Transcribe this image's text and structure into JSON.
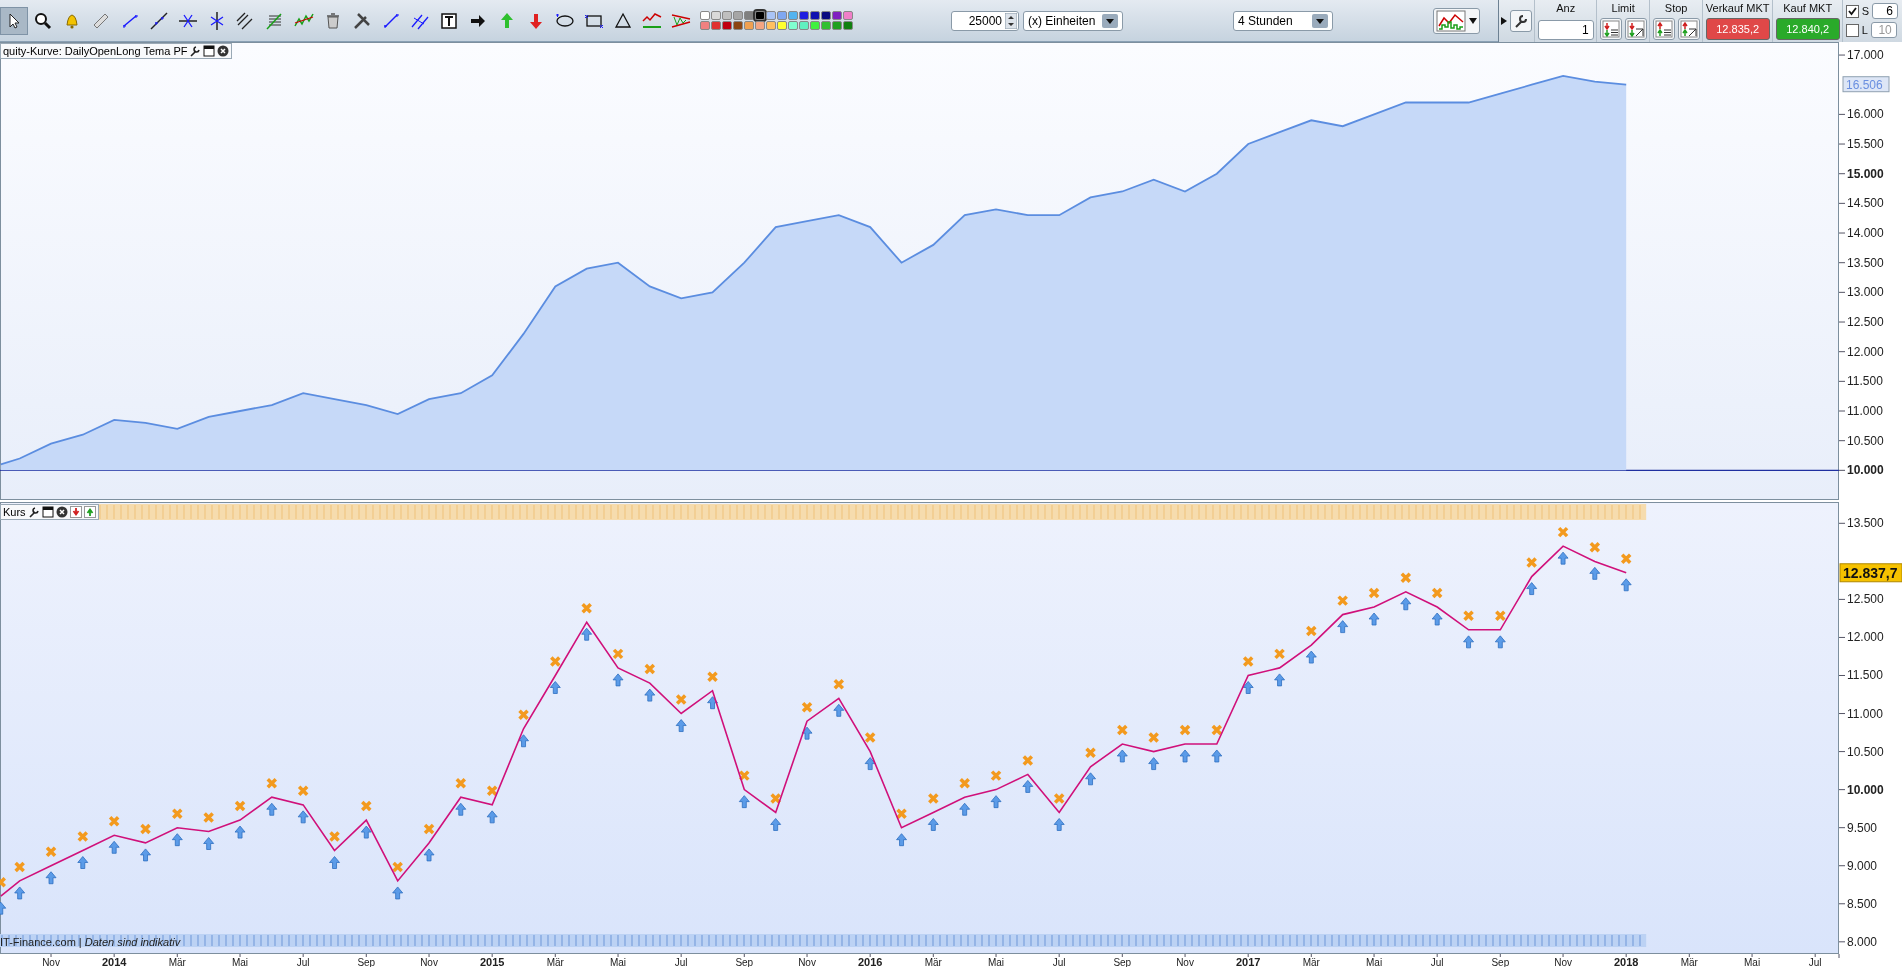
{
  "toolbar": {
    "tools": [
      {
        "kind": "pointer",
        "selected": true
      },
      {
        "kind": "search",
        "selected": false
      },
      {
        "kind": "alert",
        "selected": false
      },
      {
        "kind": "ruler",
        "selected": false
      },
      {
        "kind": "segment",
        "selected": false
      },
      {
        "kind": "line",
        "selected": false
      },
      {
        "kind": "hline",
        "selected": false
      },
      {
        "kind": "vline",
        "selected": false
      },
      {
        "kind": "channel",
        "selected": false
      },
      {
        "kind": "fibonacci",
        "selected": false
      },
      {
        "kind": "wave",
        "selected": false
      },
      {
        "kind": "trash",
        "selected": false
      },
      {
        "kind": "tools",
        "selected": false
      },
      {
        "kind": "cross",
        "selected": false
      },
      {
        "kind": "parallel",
        "selected": false
      },
      {
        "kind": "text",
        "selected": false
      },
      {
        "kind": "arrow-right",
        "selected": false
      },
      {
        "kind": "arrow-up",
        "selected": false
      },
      {
        "kind": "arrow-down",
        "selected": false
      },
      {
        "kind": "ellipse",
        "selected": false
      },
      {
        "kind": "rectangle",
        "selected": false
      },
      {
        "kind": "triangle",
        "selected": false
      },
      {
        "kind": "trend",
        "selected": false
      },
      {
        "kind": "wedge",
        "selected": false
      }
    ],
    "palette": [
      {
        "color": "#ffffff",
        "selected": false
      },
      {
        "color": "#d9d9d9",
        "selected": false
      },
      {
        "color": "#bfbfbf",
        "selected": false
      },
      {
        "color": "#a6a6a6",
        "selected": false
      },
      {
        "color": "#808080",
        "selected": false
      },
      {
        "color": "#000000",
        "selected": true
      },
      {
        "color": "#a9c4f5",
        "selected": false
      },
      {
        "color": "#7fa7f0",
        "selected": false
      },
      {
        "color": "#53b3ee",
        "selected": false
      },
      {
        "color": "#1f1fe0",
        "selected": false
      },
      {
        "color": "#1010b0",
        "selected": false
      },
      {
        "color": "#0a0a80",
        "selected": false
      },
      {
        "color": "#8020c0",
        "selected": false
      },
      {
        "color": "#f07fc8",
        "selected": false
      },
      {
        "color": "#f08080",
        "selected": false
      },
      {
        "color": "#e03030",
        "selected": false
      },
      {
        "color": "#c00010",
        "selected": false
      },
      {
        "color": "#8b4513",
        "selected": false
      },
      {
        "color": "#f0a050",
        "selected": false
      },
      {
        "color": "#f4a582",
        "selected": false
      },
      {
        "color": "#ffc060",
        "selected": false
      },
      {
        "color": "#ffff30",
        "selected": false
      },
      {
        "color": "#80ffd0",
        "selected": false
      },
      {
        "color": "#60f0c0",
        "selected": false
      },
      {
        "color": "#40f040",
        "selected": false
      },
      {
        "color": "#30c030",
        "selected": false
      },
      {
        "color": "#20a020",
        "selected": false
      },
      {
        "color": "#108010",
        "selected": false
      }
    ],
    "quantity": {
      "value": "25000"
    },
    "unit_dropdown": {
      "value": "(x) Einheiten"
    },
    "timeframe_dropdown": {
      "value": "4 Stunden"
    },
    "order_panel": {
      "quantity_label": "Anz",
      "quantity": "1",
      "limit_label": "Limit",
      "stop_label": "Stop",
      "sell": {
        "label": "Verkauf MKT",
        "price": "12.835,2"
      },
      "buy": {
        "label": "Kauf MKT",
        "price": "12.840,2"
      },
      "options": [
        {
          "label": "S",
          "checked": true,
          "value": "6"
        },
        {
          "label": "L",
          "checked": false,
          "value": "10"
        }
      ]
    }
  },
  "equity_panel": {
    "last_value": "16.506",
    "chart_data": {
      "type": "area",
      "x": [
        2013.7,
        2013.75,
        2013.833,
        2013.917,
        2014,
        2014.083,
        2014.167,
        2014.25,
        2014.333,
        2014.417,
        2014.5,
        2014.583,
        2014.667,
        2014.75,
        2014.833,
        2014.917,
        2015,
        2015.083,
        2015.167,
        2015.25,
        2015.333,
        2015.417,
        2015.5,
        2015.583,
        2015.667,
        2015.75,
        2015.833,
        2015.917,
        2016,
        2016.083,
        2016.167,
        2016.25,
        2016.333,
        2016.417,
        2016.5,
        2016.583,
        2016.667,
        2016.75,
        2016.833,
        2016.917,
        2017,
        2017.083,
        2017.167,
        2017.25,
        2017.333,
        2017.417,
        2017.5,
        2017.583,
        2017.667,
        2017.75,
        2017.833,
        2017.917,
        2018
      ],
      "series": [
        {
          "name": "quity-Kurve: DailyOpenLong Tema PF",
          "color": "#5b8de0",
          "values": [
            10100,
            10200,
            10450,
            10600,
            10850,
            10800,
            10700,
            10900,
            11000,
            11100,
            11300,
            11200,
            11100,
            10950,
            11200,
            11300,
            11600,
            12300,
            13100,
            13400,
            13500,
            13100,
            12900,
            13000,
            13500,
            14100,
            14200,
            14300,
            14100,
            13500,
            13800,
            14300,
            14400,
            14300,
            14300,
            14600,
            14700,
            14900,
            14700,
            15000,
            15500,
            15700,
            15900,
            15800,
            16000,
            16200,
            16200,
            16200,
            16350,
            16500,
            16650,
            16550,
            16500
          ]
        }
      ],
      "xlim": [
        2013.698,
        2018.563
      ],
      "ylim": [
        9500,
        17220
      ],
      "yticks": [
        {
          "value": 10000,
          "label": "10.000"
        },
        {
          "value": 10500,
          "label": "10.500"
        },
        {
          "value": 11000,
          "label": "11.000"
        },
        {
          "value": 11500,
          "label": "11.500"
        },
        {
          "value": 12000,
          "label": "12.000"
        },
        {
          "value": 12500,
          "label": "12.500"
        },
        {
          "value": 13000,
          "label": "13.000"
        },
        {
          "value": 13500,
          "label": "13.500"
        },
        {
          "value": 14000,
          "label": "14.000"
        },
        {
          "value": 14500,
          "label": "14.500"
        },
        {
          "value": 15000,
          "label": "15.000"
        },
        {
          "value": 15500,
          "label": "15.500"
        },
        {
          "value": 16000,
          "label": "16.000"
        },
        {
          "value": 17000,
          "label": "17.000"
        }
      ]
    }
  },
  "price_panel": {
    "last_value": "12.837,7",
    "footer": "IT-Finance.com | *Daten sind indikativ*",
    "chart_data": {
      "type": "line",
      "x": [
        2013.7,
        2013.75,
        2013.833,
        2013.917,
        2014,
        2014.083,
        2014.167,
        2014.25,
        2014.333,
        2014.417,
        2014.5,
        2014.583,
        2014.667,
        2014.75,
        2014.833,
        2014.917,
        2015,
        2015.083,
        2015.167,
        2015.25,
        2015.333,
        2015.417,
        2015.5,
        2015.583,
        2015.667,
        2015.75,
        2015.833,
        2015.917,
        2016,
        2016.083,
        2016.167,
        2016.25,
        2016.333,
        2016.417,
        2016.5,
        2016.583,
        2016.667,
        2016.75,
        2016.833,
        2016.917,
        2017,
        2017.083,
        2017.167,
        2017.25,
        2017.333,
        2017.417,
        2017.5,
        2017.583,
        2017.667,
        2017.75,
        2017.833,
        2017.917,
        2018
      ],
      "series": [
        {
          "name": "Kurs",
          "color": "#d0107a",
          "values": [
            8600,
            8800,
            9000,
            9200,
            9400,
            9300,
            9500,
            9450,
            9600,
            9900,
            9800,
            9200,
            9600,
            8800,
            9300,
            9900,
            9800,
            10800,
            11500,
            12200,
            11600,
            11400,
            11000,
            11300,
            10000,
            9700,
            10900,
            11200,
            10500,
            9500,
            9700,
            9900,
            10000,
            10200,
            9700,
            10300,
            10600,
            10500,
            10600,
            10600,
            11500,
            11600,
            11900,
            12300,
            12400,
            12600,
            12400,
            12100,
            12100,
            12800,
            13200,
            13000,
            12850
          ]
        }
      ],
      "xlim": [
        2013.698,
        2018.563
      ],
      "ylim": [
        7840,
        13780
      ],
      "xticks": [
        {
          "value": 2013.833,
          "label": "Nov"
        },
        {
          "value": 2014,
          "label": "2014"
        },
        {
          "value": 2014.167,
          "label": "Mär"
        },
        {
          "value": 2014.333,
          "label": "Mai"
        },
        {
          "value": 2014.5,
          "label": "Jul"
        },
        {
          "value": 2014.667,
          "label": "Sep"
        },
        {
          "value": 2014.833,
          "label": "Nov"
        },
        {
          "value": 2015,
          "label": "2015"
        },
        {
          "value": 2015.167,
          "label": "Mär"
        },
        {
          "value": 2015.333,
          "label": "Mai"
        },
        {
          "value": 2015.5,
          "label": "Jul"
        },
        {
          "value": 2015.667,
          "label": "Sep"
        },
        {
          "value": 2015.833,
          "label": "Nov"
        },
        {
          "value": 2016,
          "label": "2016"
        },
        {
          "value": 2016.167,
          "label": "Mär"
        },
        {
          "value": 2016.333,
          "label": "Mai"
        },
        {
          "value": 2016.5,
          "label": "Jul"
        },
        {
          "value": 2016.667,
          "label": "Sep"
        },
        {
          "value": 2016.833,
          "label": "Nov"
        },
        {
          "value": 2017,
          "label": "2017"
        },
        {
          "value": 2017.167,
          "label": "Mär"
        },
        {
          "value": 2017.333,
          "label": "Mai"
        },
        {
          "value": 2017.5,
          "label": "Jul"
        },
        {
          "value": 2017.667,
          "label": "Sep"
        },
        {
          "value": 2017.833,
          "label": "Nov"
        },
        {
          "value": 2018,
          "label": "2018"
        },
        {
          "value": 2018.167,
          "label": "Mär"
        },
        {
          "value": 2018.333,
          "label": "Mai"
        },
        {
          "value": 2018.5,
          "label": "Jul"
        }
      ],
      "yticks": [
        {
          "value": 8000,
          "label": "8.000"
        },
        {
          "value": 8500,
          "label": "8.500"
        },
        {
          "value": 9000,
          "label": "9.000"
        },
        {
          "value": 9500,
          "label": "9.500"
        },
        {
          "value": 10000,
          "label": "10.000"
        },
        {
          "value": 10500,
          "label": "10.500"
        },
        {
          "value": 11000,
          "label": "11.000"
        },
        {
          "value": 11500,
          "label": "11.500"
        },
        {
          "value": 12000,
          "label": "12.000"
        },
        {
          "value": 12500,
          "label": "12.500"
        },
        {
          "value": 13500,
          "label": "13.500"
        }
      ]
    }
  }
}
